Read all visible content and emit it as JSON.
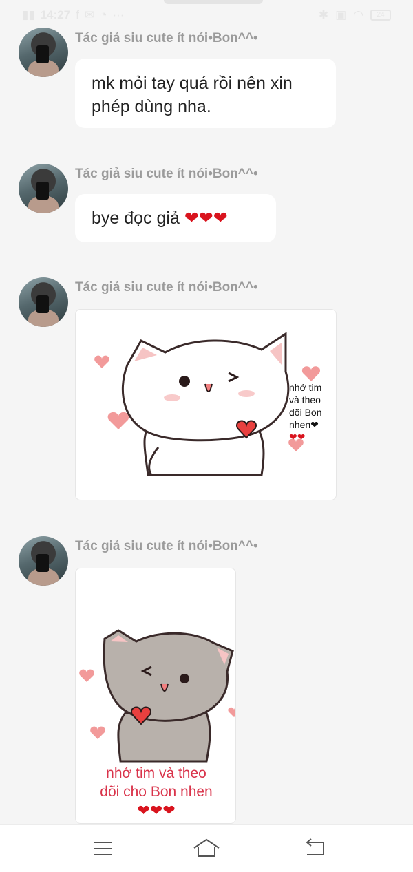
{
  "status_bar": {
    "time": "14:27",
    "battery": "24",
    "left_icons": [
      "signal-icon",
      "facebook-icon",
      "message-icon",
      "chat-icon",
      "more-icon"
    ],
    "right_icons": [
      "bluetooth-icon",
      "vibrate-icon",
      "wifi-icon",
      "battery-icon"
    ]
  },
  "messages": [
    {
      "author": "Tác giả siu cute ít nói•Bon^^•",
      "text_line1": "mk mỏi tay quá rồi nên xin",
      "text_line2": "phép dùng nha."
    },
    {
      "author": "Tác giả siu cute ít nói•Bon^^•",
      "text": "bye đọc giả",
      "hearts": "❤❤❤"
    },
    {
      "author": "Tác giả siu cute ít nói•Bon^^•",
      "sticker_caption_lines": [
        "nhớ tim",
        "và theo",
        "dõi Bon",
        "nhen❤",
        "❤❤"
      ]
    },
    {
      "author": "Tác giả siu cute ít nói•Bon^^•",
      "sticker_caption_line1": "nhớ tim và theo",
      "sticker_caption_line2": "dõi cho Bon nhen",
      "sticker_hearts": "❤❤❤"
    }
  ],
  "navbar": {
    "icons": [
      "menu-icon",
      "home-icon",
      "back-icon"
    ]
  },
  "colors": {
    "background": "#f5f5f5",
    "author_text": "#9b9b9b",
    "heart": "#d9141e",
    "sticker_text_red": "#d9334a"
  }
}
